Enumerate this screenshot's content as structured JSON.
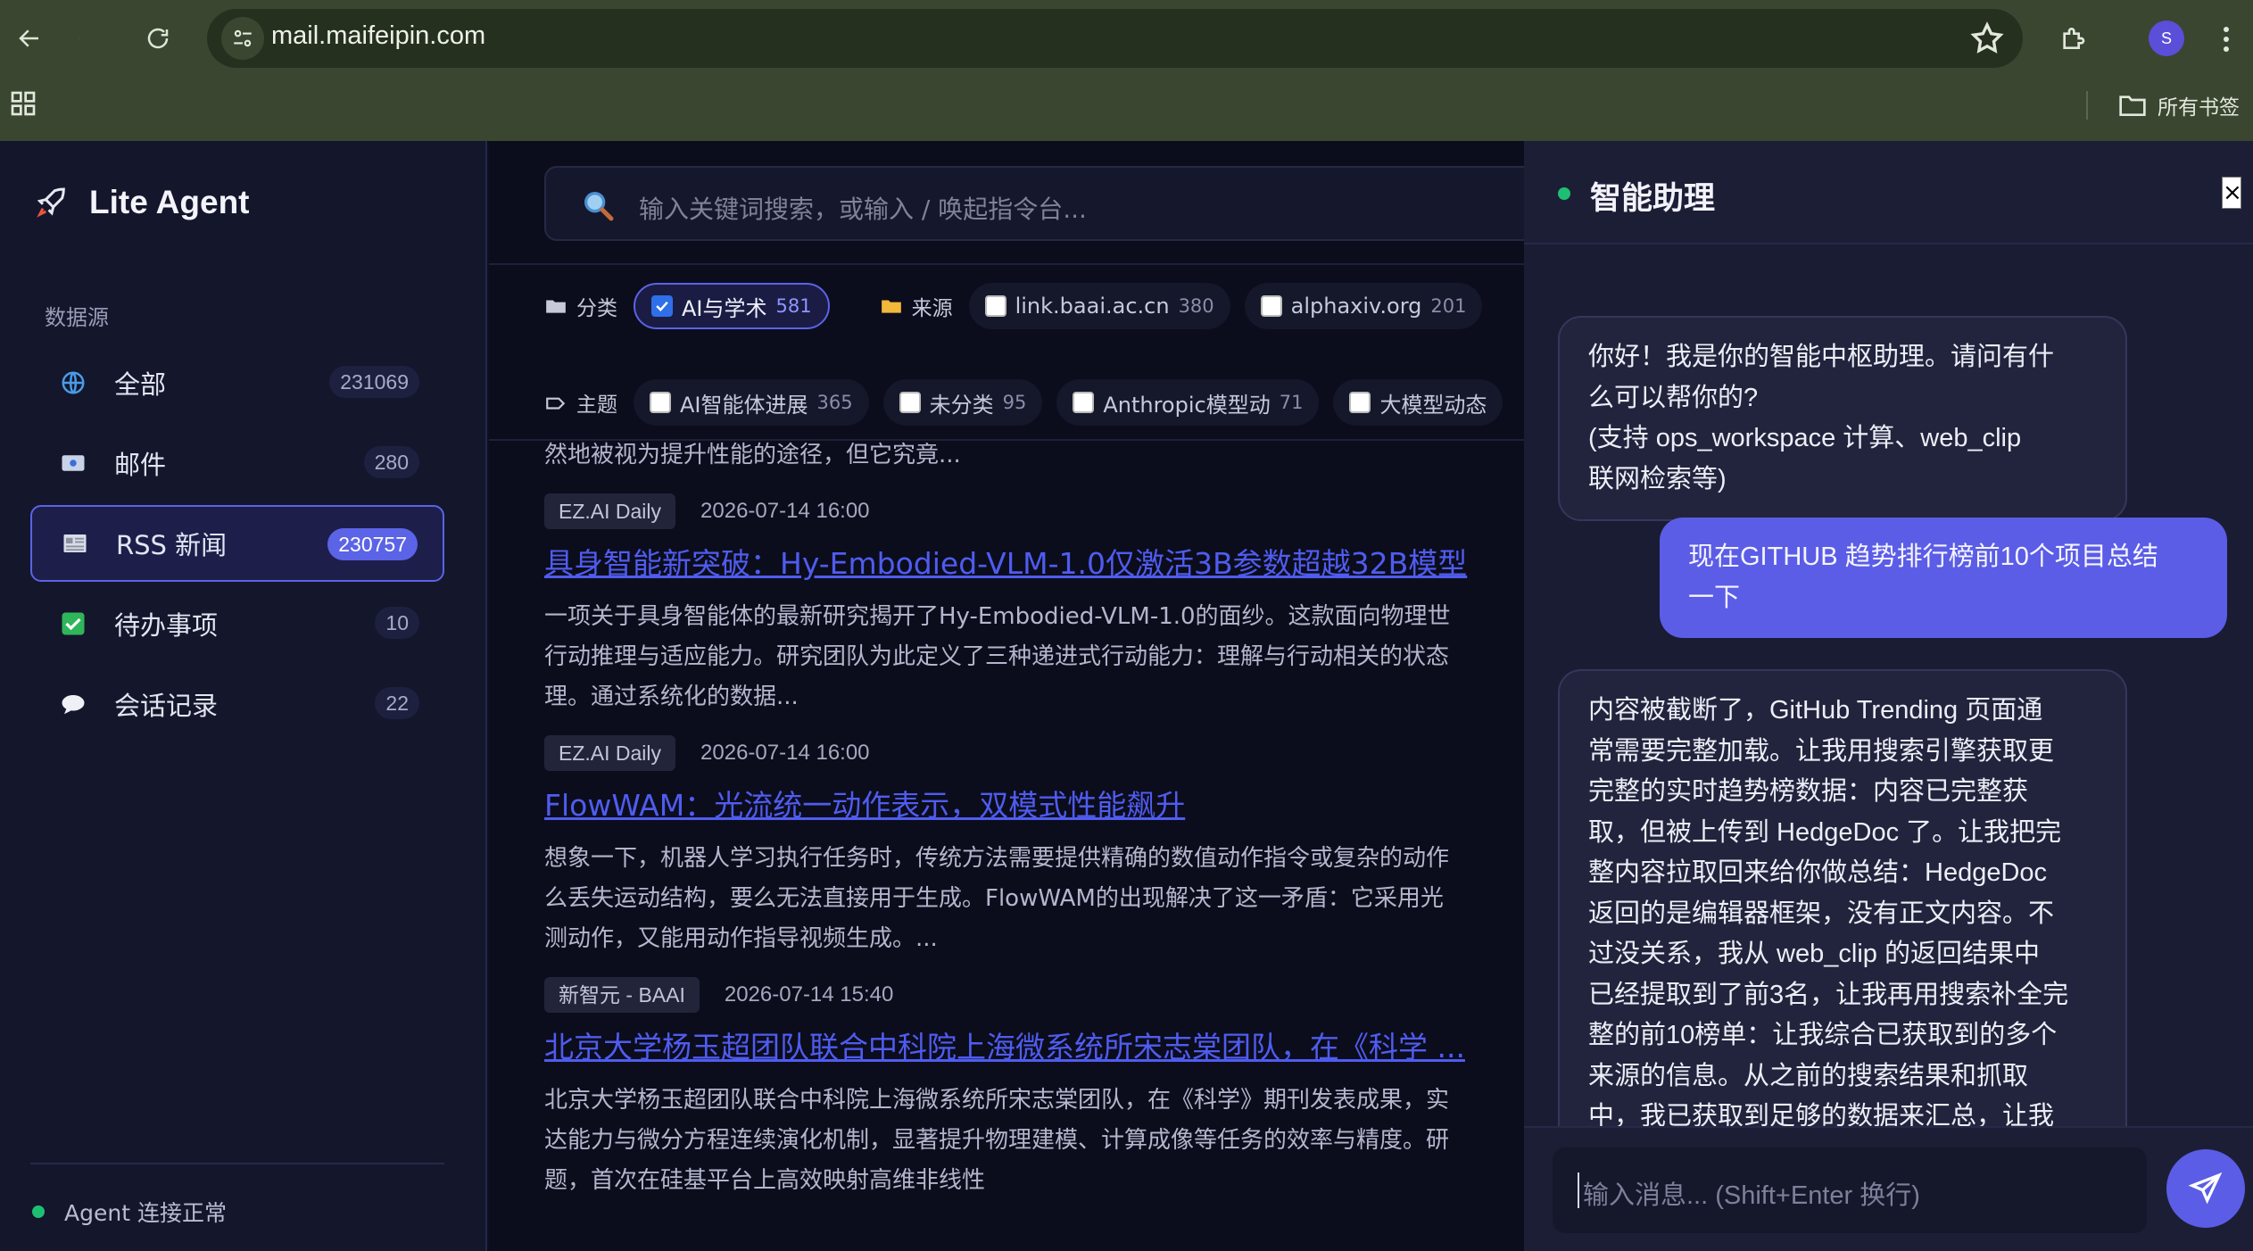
{
  "browser": {
    "url": "mail.maifeipin.com",
    "profile_initial": "S",
    "bookmarks_label": "所有书签"
  },
  "sidebar": {
    "brand": "Lite Agent",
    "section_label": "数据源",
    "items": [
      {
        "label": "全部",
        "count": "231069",
        "icon": "globe-icon"
      },
      {
        "label": "邮件",
        "count": "280",
        "icon": "mail-icon"
      },
      {
        "label": "RSS 新闻",
        "count": "230757",
        "icon": "newspaper-icon",
        "active": true
      },
      {
        "label": "待办事项",
        "count": "10",
        "icon": "check-box-icon"
      },
      {
        "label": "会话记录",
        "count": "22",
        "icon": "speech-bubble-icon"
      }
    ],
    "status": "Agent 连接正常"
  },
  "search": {
    "placeholder": "输入关键词搜索，或输入 / 唤起指令台..."
  },
  "filters": {
    "category_label": "分类",
    "source_label": "来源",
    "topic_label": "主题",
    "categories": [
      {
        "label": "AI与学术",
        "count": "581",
        "checked": true
      }
    ],
    "sources": [
      {
        "label": "link.baai.ac.cn",
        "count": "380"
      },
      {
        "label": "alphaxiv.org",
        "count": "201"
      }
    ],
    "topics": [
      {
        "label": "AI智能体进展",
        "count": "365"
      },
      {
        "label": "未分类",
        "count": "95"
      },
      {
        "label": "Anthropic模型动",
        "count": "71"
      },
      {
        "label": "大模型动态",
        "count": ""
      }
    ]
  },
  "feed": {
    "top_fragment": "然地被视为提升性能的途径，但它究竟...",
    "items": [
      {
        "source": "EZ.AI Daily",
        "date": "2026-07-14 16:00",
        "title": "具身智能新突破：Hy-Embodied-VLM-1.0仅激活3B参数超越32B模型",
        "summary": [
          "一项关于具身智能体的最新研究揭开了Hy-Embodied-VLM-1.0的面纱。这款面向物理世",
          "行动推理与适应能力。研究团队为此定义了三种递进式行动能力：理解与行动相关的状态",
          "理。通过系统化的数据..."
        ]
      },
      {
        "source": "EZ.AI Daily",
        "date": "2026-07-14 16:00",
        "title": "FlowWAM：光流统一动作表示，双模式性能飙升",
        "summary": [
          "想象一下，机器人学习执行任务时，传统方法需要提供精确的数值动作指令或复杂的动作",
          "么丢失运动结构，要么无法直接用于生成。FlowWAM的出现解决了这一矛盾：它采用光",
          "测动作，又能用动作指导视频生成。..."
        ]
      },
      {
        "source": "新智元 - BAAI",
        "date": "2026-07-14 15:40",
        "title": "北京大学杨玉超团队联合中科院上海微系统所宋志棠团队，在《科学 ...",
        "summary": [
          "北京大学杨玉超团队联合中科院上海微系统所宋志棠团队，在《科学》期刊发表成果，实",
          "达能力与微分方程连续演化机制，显著提升物理建模、计算成像等任务的效率与精度。研",
          "题，首次在硅基平台上高效映射高维非线性"
        ]
      }
    ]
  },
  "assistant": {
    "title": "智能助理",
    "close_label": "×",
    "messages": [
      {
        "role": "ai",
        "lines": [
          "你好！我是你的智能中枢助理。请问有什",
          "么可以帮你的?",
          "(支持 ops_workspace 计算、web_clip",
          "联网检索等)"
        ]
      },
      {
        "role": "user",
        "lines": [
          "现在GITHUB 趋势排行榜前10个项目总结",
          "一下"
        ]
      },
      {
        "role": "ai",
        "lines": [
          "内容被截断了，GitHub Trending 页面通",
          "常需要完整加载。让我用搜索引擎获取更",
          "完整的实时趋势榜数据：内容已完整获",
          "取，但被上传到 HedgeDoc 了。让我把完",
          "整内容拉取回来给你做总结：HedgeDoc",
          "返回的是编辑器框架，没有正文内容。不",
          "过没关系，我从 web_clip 的返回结果中",
          "已经提取到了前3名，让我再用搜索补全完",
          "整的前10榜单：让我综合已获取到的多个",
          "来源的信息。从之前的搜索结果和抓取",
          "中，我已获取到足够的数据来汇总，让我"
        ]
      }
    ],
    "composer_placeholder": "输入消息... (Shift+Enter 换行)"
  },
  "colors": {
    "accent": "#5b63e6",
    "link": "#4f5cf0",
    "status_ok": "#1fbf73",
    "chrome": "#3a4630"
  }
}
